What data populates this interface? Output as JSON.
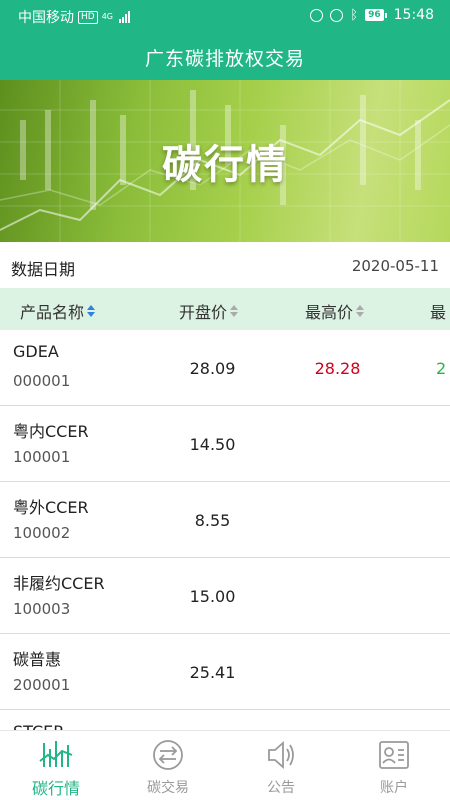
{
  "status_bar": {
    "carrier": "中国移动",
    "hd_badge": "HD",
    "network": "4G",
    "battery": "96",
    "time": "15:48"
  },
  "app": {
    "title": "广东碳排放权交易"
  },
  "banner": {
    "title": "碳行情"
  },
  "date_row": {
    "label": "数据日期",
    "value": "2020-05-11"
  },
  "table": {
    "columns": [
      "产品名称",
      "开盘价",
      "最高价",
      "最"
    ],
    "sort_active_column": "产品名称",
    "rows": [
      {
        "name": "GDEA",
        "code": "000001",
        "open": "28.09",
        "high": "28.28",
        "low": "2"
      },
      {
        "name": "粤内CCER",
        "code": "100001",
        "open": "14.50",
        "high": "",
        "low": ""
      },
      {
        "name": "粤外CCER",
        "code": "100002",
        "open": "8.55",
        "high": "",
        "low": ""
      },
      {
        "name": "非履约CCER",
        "code": "100003",
        "open": "15.00",
        "high": "",
        "low": ""
      },
      {
        "name": "碳普惠",
        "code": "200001",
        "open": "25.41",
        "high": "",
        "low": ""
      },
      {
        "name": "STCER",
        "code": "",
        "open": "",
        "high": "",
        "low": ""
      }
    ]
  },
  "bottom_nav": {
    "tabs": [
      {
        "label": "碳行情",
        "icon": "market-chart-icon",
        "active": true
      },
      {
        "label": "碳交易",
        "icon": "exchange-icon",
        "active": false
      },
      {
        "label": "公告",
        "icon": "speaker-icon",
        "active": false
      },
      {
        "label": "账户",
        "icon": "account-card-icon",
        "active": false
      }
    ]
  },
  "colors": {
    "brand_green": "#21b686",
    "header_row_bg": "#dcf2e2",
    "price_up_red": "#d0021b",
    "price_down_green": "#2bb34a",
    "sort_active_blue": "#2f80e0"
  }
}
